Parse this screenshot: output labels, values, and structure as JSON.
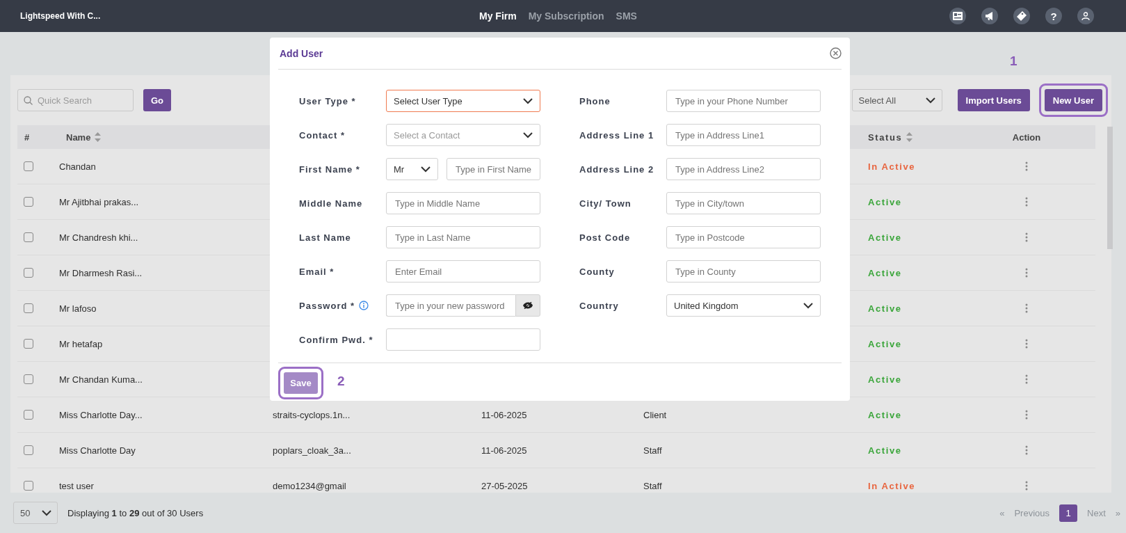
{
  "topbar": {
    "title": "Lightspeed With C...",
    "nav": [
      {
        "label": "My Firm",
        "selected": true
      },
      {
        "label": "My Subscription",
        "selected": false
      },
      {
        "label": "SMS",
        "selected": false
      }
    ],
    "icons": [
      {
        "kind": "card"
      },
      {
        "kind": "megaphone"
      },
      {
        "kind": "tag"
      },
      {
        "kind": "help",
        "label": "?"
      },
      {
        "kind": "user"
      }
    ]
  },
  "toolbar": {
    "search": {
      "placeholder": "Quick Search"
    },
    "go_button": "Go",
    "filter": {
      "value": "Select All"
    },
    "buttons": [
      {
        "label": "Import Users",
        "highlighted": false
      },
      {
        "label": "New User",
        "highlighted": true,
        "callout": "1"
      }
    ]
  },
  "table": {
    "columns": [
      {
        "kind": "check",
        "label": "#",
        "sortable": false
      },
      {
        "kind": "name",
        "label": "Name",
        "sortable": true
      },
      {
        "kind": "status",
        "label": "Status",
        "sortable": true
      },
      {
        "kind": "action",
        "label": "Action",
        "sortable": false
      }
    ],
    "rows": [
      {
        "checked": false,
        "name": "Chandan",
        "status": "In Active",
        "active": false
      },
      {
        "checked": false,
        "name": "Mr Ajitbhai prakas...",
        "status": "Active",
        "active": true
      },
      {
        "checked": false,
        "name": "Mr Chandresh khi...",
        "status": "Active",
        "active": true
      },
      {
        "checked": false,
        "name": "Mr Dharmesh Rasi...",
        "status": "Active",
        "active": true
      },
      {
        "checked": false,
        "name": "Mr lafoso",
        "status": "Active",
        "active": true
      },
      {
        "checked": false,
        "name": "Mr hetafap",
        "status": "Active",
        "active": true
      },
      {
        "checked": false,
        "name": "Mr Chandan Kuma...",
        "status": "Active",
        "active": true
      },
      {
        "checked": false,
        "name": "Miss Charlotte Day...",
        "email": "straits-cyclops.1n...",
        "date": "11-06-2025",
        "type": "Client",
        "status": "Active",
        "active": true
      },
      {
        "checked": false,
        "name": "Miss Charlotte Day",
        "email": "poplars_cloak_3a...",
        "date": "11-06-2025",
        "type": "Staff",
        "status": "Active",
        "active": true
      },
      {
        "checked": false,
        "name": "test user",
        "email": "demo1234@gmail",
        "date": "27-05-2025",
        "type": "Staff",
        "status": "In Active",
        "active": false
      }
    ]
  },
  "modal": {
    "title": "Add User",
    "left_fields": [
      {
        "label": "User Type *",
        "kind": "select",
        "value": "Select User Type",
        "invalid": true
      },
      {
        "label": "Contact *",
        "kind": "select",
        "placeholder": "Select a Contact",
        "invalid": false
      },
      {
        "label": "First Name *",
        "kind": "title_name",
        "title": "Mr",
        "placeholder": "Type in First Name"
      },
      {
        "label": "Middle Name",
        "kind": "input",
        "placeholder": "Type in Middle Name"
      },
      {
        "label": "Last Name",
        "kind": "input",
        "placeholder": "Type in Last Name"
      },
      {
        "label": "Email *",
        "kind": "input",
        "placeholder": "Enter Email"
      },
      {
        "label": "Password *",
        "kind": "password",
        "placeholder": "Type in your new password",
        "info": true
      },
      {
        "label": "Confirm Pwd. *",
        "kind": "input"
      }
    ],
    "right_fields": [
      {
        "label": "Phone",
        "kind": "input",
        "placeholder": "Type in your Phone Number"
      },
      {
        "label": "Address Line 1",
        "kind": "input",
        "placeholder": "Type in Address Line1"
      },
      {
        "label": "Address Line 2",
        "kind": "input",
        "placeholder": "Type in Address Line2"
      },
      {
        "label": "City/ Town",
        "kind": "input",
        "placeholder": "Type in City/town"
      },
      {
        "label": "Post Code",
        "kind": "input",
        "placeholder": "Type in Postcode"
      },
      {
        "label": "County",
        "kind": "input",
        "placeholder": "Type in County"
      },
      {
        "label": "Country",
        "kind": "select",
        "value": "United Kingdom",
        "invalid": false
      }
    ],
    "save": {
      "label": "Save",
      "disabled": true,
      "highlighted": true,
      "callout": "2"
    }
  },
  "footer": {
    "page_size": "50",
    "summary": "Displaying **1** to **29** out of 30 Users",
    "pagination": {
      "first": {
        "label": "«",
        "disabled": true
      },
      "previous": {
        "label": "Previous",
        "disabled": true
      },
      "pages": [
        {
          "label": "1",
          "selected": true
        }
      ],
      "next": {
        "label": "Next",
        "disabled": true
      },
      "last": {
        "label": "»",
        "disabled": true
      }
    }
  }
}
